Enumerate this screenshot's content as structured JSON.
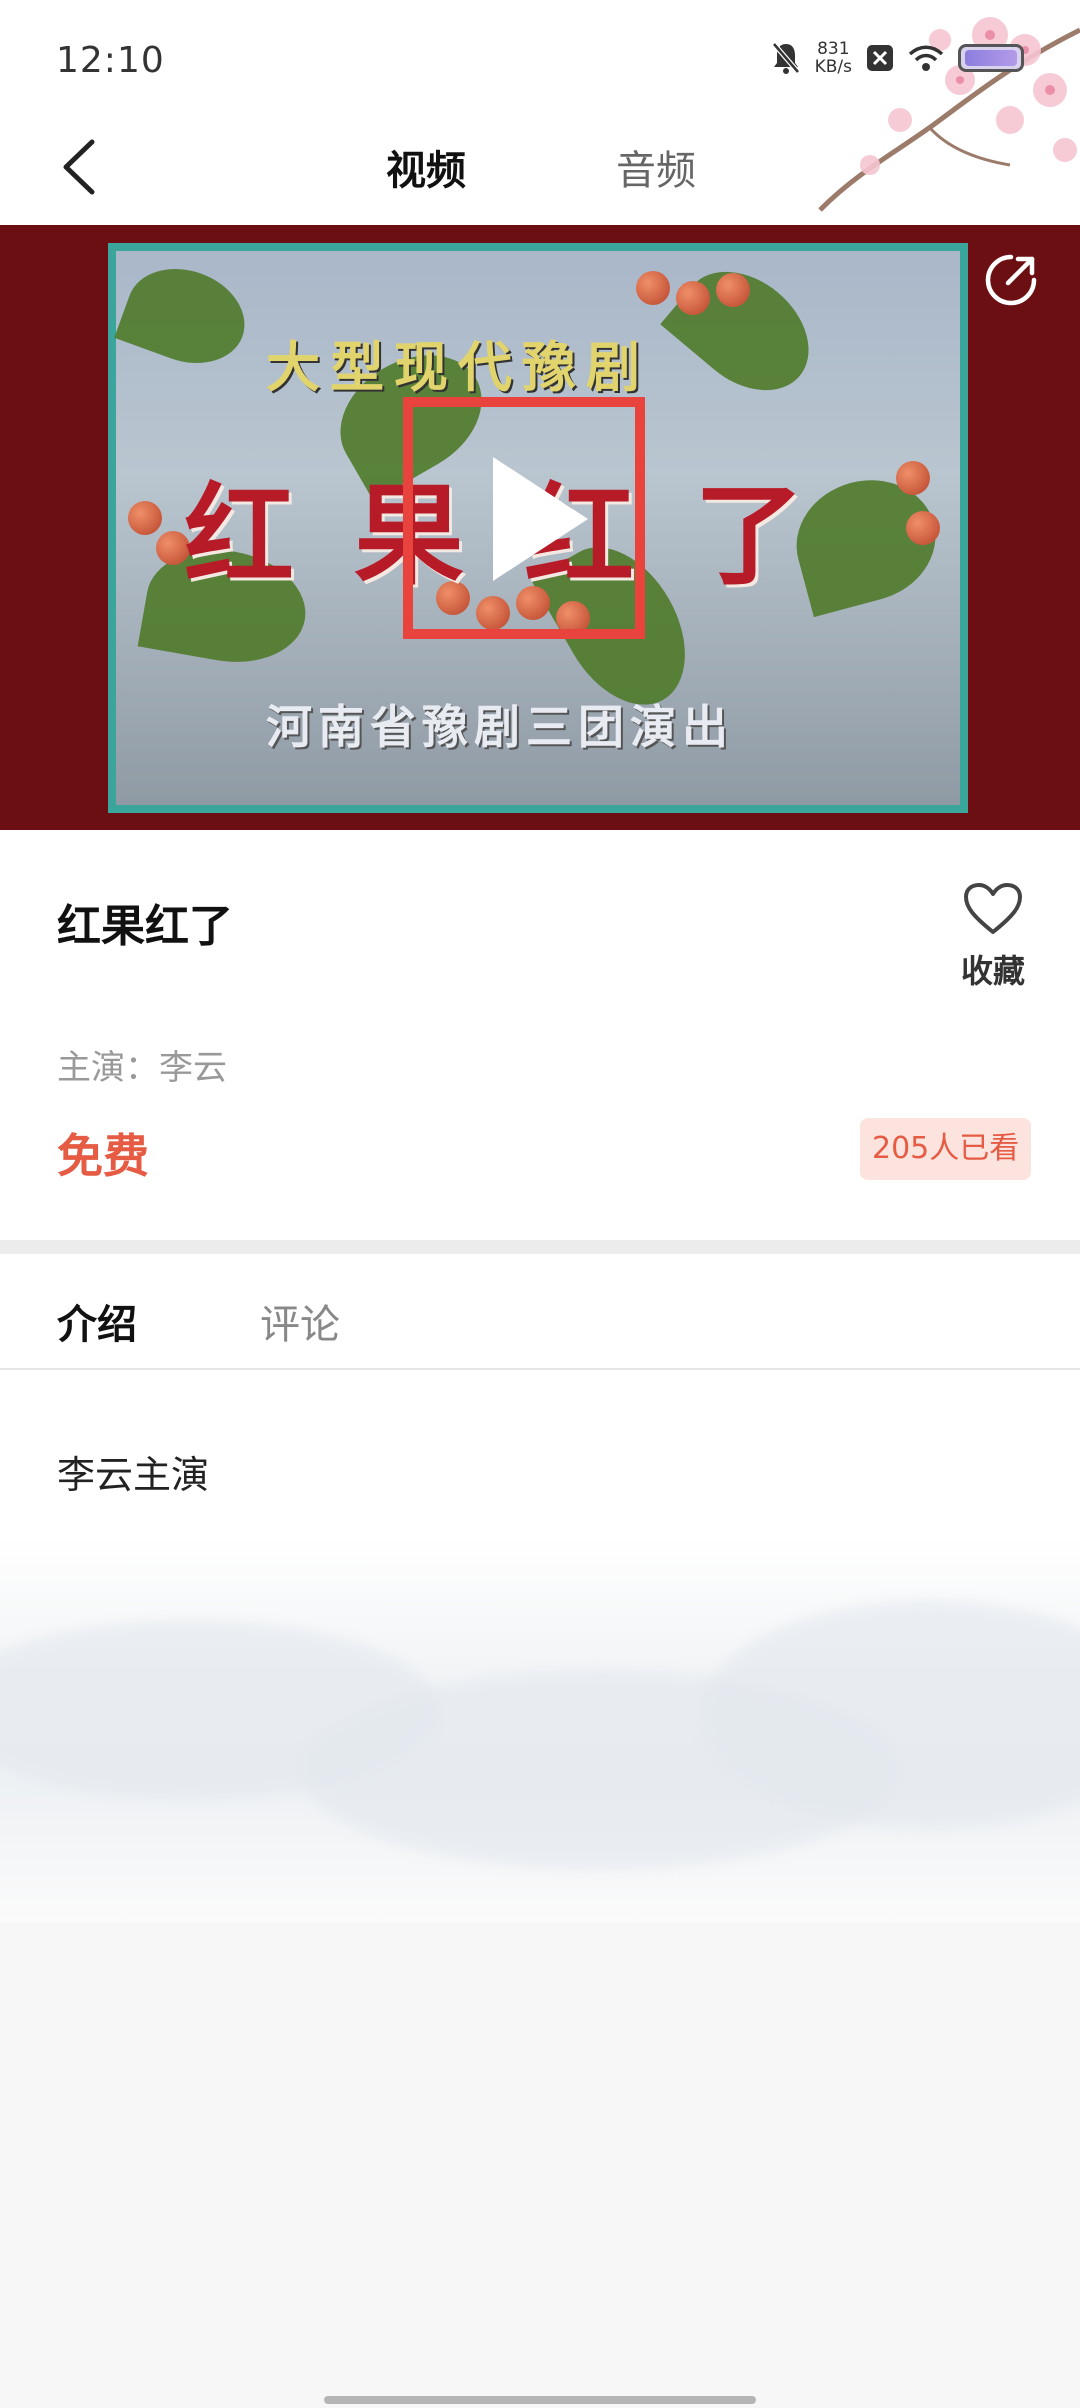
{
  "status_bar": {
    "time": "12:10",
    "speed_value": "831",
    "speed_unit": "KB/s"
  },
  "nav": {
    "tabs": [
      {
        "label": "视频",
        "active": true
      },
      {
        "label": "音频",
        "active": false
      }
    ]
  },
  "video": {
    "overlay_lines": [
      "大型现代豫剧",
      "红果红了",
      "河南省豫剧三团演出"
    ]
  },
  "detail": {
    "title": "红果红了",
    "favorite_label": "收藏",
    "actor": "主演：李云",
    "price": "免费",
    "viewers": "205人已看"
  },
  "content_tabs": [
    {
      "label": "介绍",
      "active": true
    },
    {
      "label": "评论",
      "active": false
    }
  ],
  "intro": {
    "text": "李云主演"
  },
  "colors": {
    "accent": "#e55b43",
    "video_bg": "#6b0f12",
    "play_box": "#e8433c"
  }
}
